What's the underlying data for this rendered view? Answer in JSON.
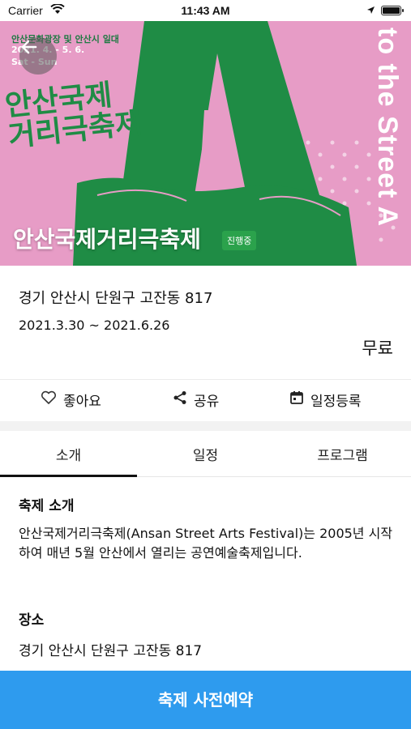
{
  "status_bar": {
    "carrier": "Carrier",
    "time": "11:43 AM"
  },
  "hero": {
    "poster_line1": "안산문화광장 및 안산시 일대",
    "poster_line2": "2021. 4. - 5. 6.",
    "poster_line3": "Sat - Sun",
    "poster_logo_line1": "안산국제",
    "poster_logo_line2": "거리극축제",
    "poster_vertical_text": "to the Street A",
    "title": "안산국제거리극축제",
    "status_badge": "진행중"
  },
  "info": {
    "address": "경기 안산시 단원구 고잔동 817",
    "dates": "2021.3.30 ~ 2021.6.26",
    "price": "무료"
  },
  "actions": {
    "like": "좋아요",
    "share": "공유",
    "calendar": "일정등록"
  },
  "tabs": [
    {
      "label": "소개"
    },
    {
      "label": "일정"
    },
    {
      "label": "프로그램"
    }
  ],
  "intro": {
    "heading": "축제 소개",
    "body": "안산국제거리극축제(Ansan Street Arts Festival)는 2005년 시작하여 매년 5월 안산에서 열리는 공연예술축제입니다.",
    "place_heading": "장소",
    "place": "경기 안산시 단원구 고잔동 817"
  },
  "cta": {
    "label": "축제 사전예약"
  },
  "colors": {
    "accent": "#2e9bee",
    "badge": "#2ba24c",
    "poster_pink": "#e79cc6",
    "poster_green": "#1f8c45"
  }
}
